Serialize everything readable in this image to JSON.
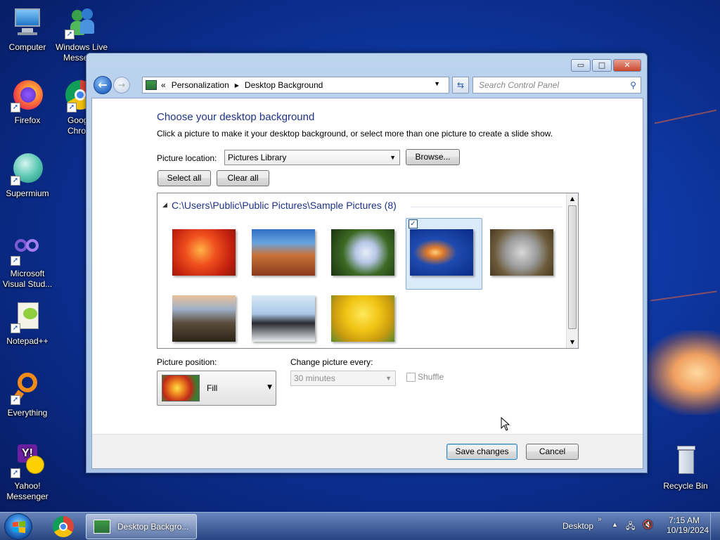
{
  "desktop": {
    "icons": [
      {
        "label": "Computer",
        "icon": "computer-icon"
      },
      {
        "label": "Windows Live Messen...",
        "icon": "windows-live-messenger-icon"
      },
      {
        "label": "Firefox",
        "icon": "firefox-icon"
      },
      {
        "label": "Goog Chro",
        "icon": "google-chrome-icon"
      },
      {
        "label": "Supermium",
        "icon": "supermium-icon"
      },
      {
        "label": "Microsoft Visual Stud...",
        "icon": "visual-studio-icon"
      },
      {
        "label": "Notepad++",
        "icon": "notepad-plus-plus-icon"
      },
      {
        "label": "Everything",
        "icon": "everything-icon"
      },
      {
        "label": "Yahoo! Messenger",
        "icon": "yahoo-messenger-icon"
      },
      {
        "label": "Recycle Bin",
        "icon": "recycle-bin-icon"
      }
    ]
  },
  "window": {
    "controls": {
      "minimize": "▭",
      "maximize": "□",
      "close": "✕"
    },
    "address": {
      "prefix": "«",
      "crumb1": "Personalization",
      "sep": "▶",
      "crumb2": "Desktop Background"
    },
    "search_placeholder": "Search Control Panel",
    "heading": "Choose your desktop background",
    "subtext": "Click a picture to make it your desktop background, or select more than one picture to create a slide show.",
    "picture_location_label": "Picture location:",
    "picture_location_value": "Pictures Library",
    "browse_label": "Browse...",
    "select_all_label": "Select all",
    "clear_all_label": "Clear all",
    "gallery_path": "C:\\Users\\Public\\Public Pictures\\Sample Pictures (8)",
    "pictures": [
      {
        "name": "chrysanthemum",
        "selected": false
      },
      {
        "name": "desert",
        "selected": false
      },
      {
        "name": "hydrangeas",
        "selected": false
      },
      {
        "name": "jellyfish",
        "selected": true
      },
      {
        "name": "koala",
        "selected": false
      },
      {
        "name": "lighthouse",
        "selected": false
      },
      {
        "name": "penguins",
        "selected": false
      },
      {
        "name": "tulips",
        "selected": false
      }
    ],
    "picture_position_label": "Picture position:",
    "picture_position_value": "Fill",
    "change_every_label": "Change picture every:",
    "change_every_value": "30 minutes",
    "shuffle_label": "Shuffle",
    "save_label": "Save changes",
    "cancel_label": "Cancel"
  },
  "taskbar": {
    "task_label": "Desktop Backgro...",
    "desktop_label": "Desktop",
    "time": "7:15 AM",
    "date": "10/19/2024"
  },
  "colors": {
    "heading": "#1e3287",
    "accent": "#2a6bc6"
  }
}
